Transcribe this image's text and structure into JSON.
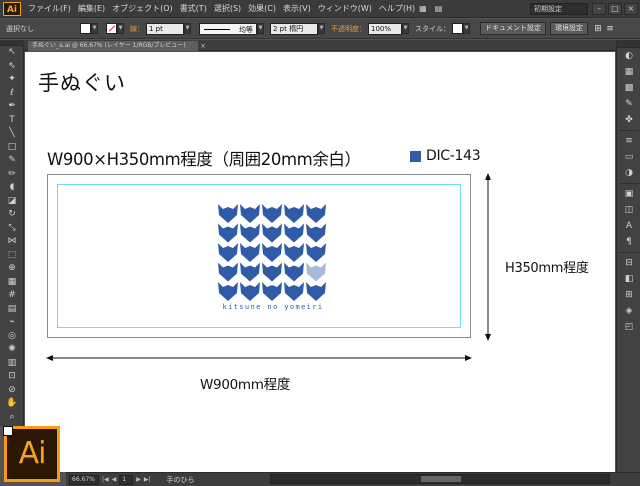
{
  "app": {
    "logo_text": "Ai",
    "brand_color": "#f7a21c"
  },
  "menubar": {
    "items": [
      "ファイル(F)",
      "編集(E)",
      "オブジェクト(O)",
      "書式(T)",
      "選択(S)",
      "効果(C)",
      "表示(V)",
      "ウィンドウ(W)",
      "ヘルプ(H)"
    ],
    "workspace": "初期設定"
  },
  "controlbar": {
    "selection_label": "選択なし",
    "stroke_label": "線：",
    "stroke_weight": "1 pt",
    "stroke_profile": "均等",
    "brush_label": "2 pt 楕円",
    "opacity_label": "不透明度：",
    "opacity_value": "100%",
    "style_label": "スタイル：",
    "doc_setup_button": "ドキュメント設定",
    "prefs_button": "環境設定"
  },
  "document": {
    "tab_title": "手ぬぐい_a.ai @ 66.67% (レイヤー 1/RGB/プレビュー)"
  },
  "artboard": {
    "title": "手ぬぐい",
    "spec": "W900×H350mm程度（周囲20mm余白）",
    "color_name": "DIC-143",
    "color_hex": "#2f5ba8",
    "caption": "kitsune no yomeiri",
    "height_label": "H350mm程度",
    "width_label": "W900mm程度"
  },
  "statusbar": {
    "zoom": "66.67%",
    "artboard_number": "1",
    "current_tool": "手のひら"
  },
  "tools": [
    "selection-tool",
    "direct-selection-tool",
    "magic-wand-tool",
    "lasso-tool",
    "pen-tool",
    "type-tool",
    "line-tool",
    "rectangle-tool",
    "paintbrush-tool",
    "pencil-tool",
    "blob-brush-tool",
    "eraser-tool",
    "rotate-tool",
    "scale-tool",
    "width-tool",
    "free-transform-tool",
    "shape-builder-tool",
    "perspective-grid-tool",
    "mesh-tool",
    "gradient-tool",
    "eyedropper-tool",
    "blend-tool",
    "symbol-sprayer-tool",
    "column-graph-tool",
    "artboard-tool",
    "slice-tool",
    "hand-tool",
    "zoom-tool"
  ]
}
